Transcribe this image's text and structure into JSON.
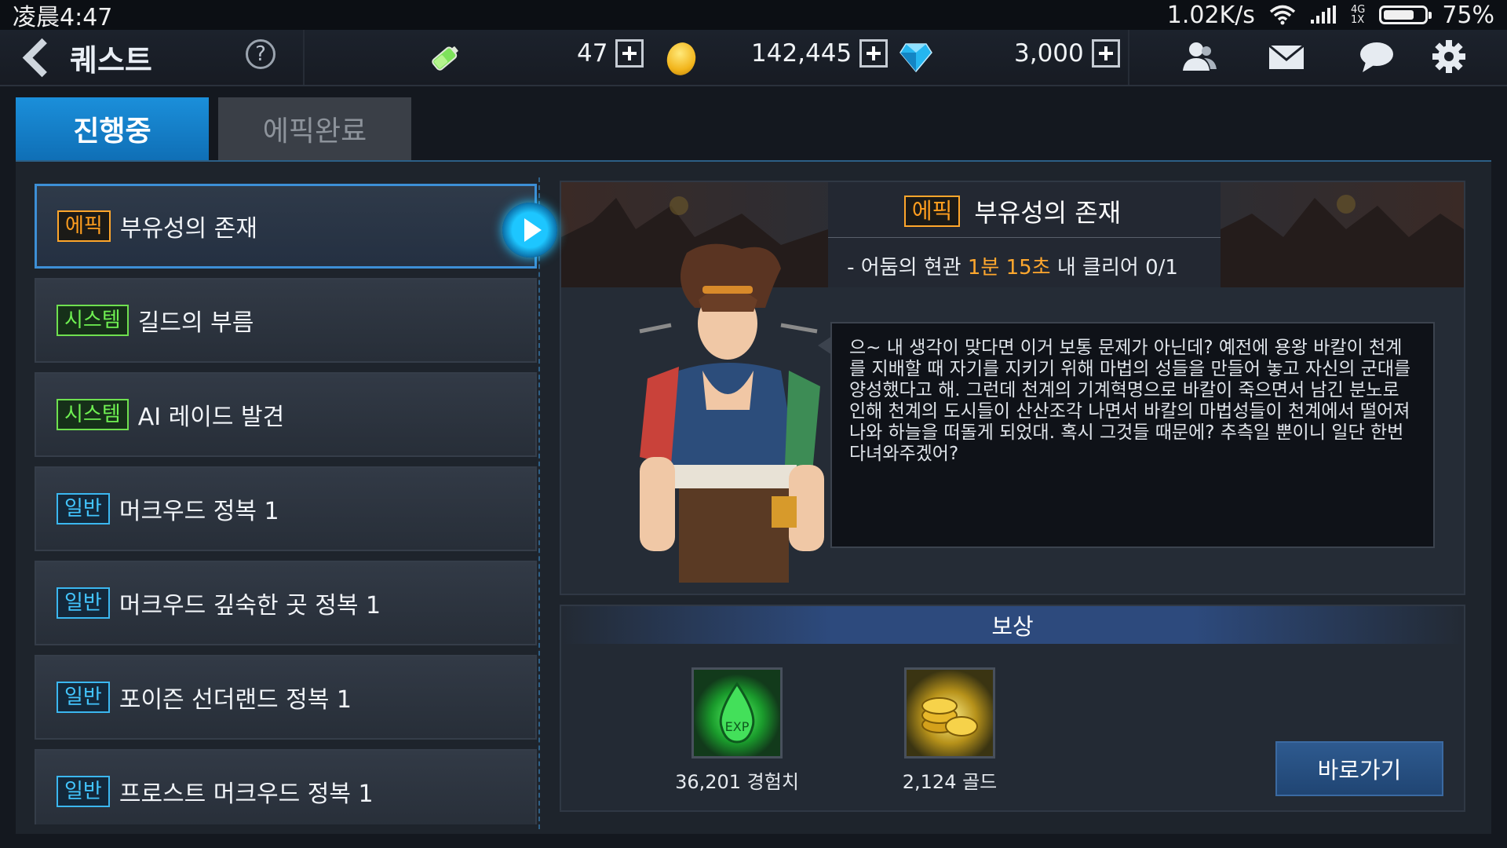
{
  "status_bar": {
    "time": "凌晨4:47",
    "network_speed": "1.02K/s",
    "network_type_top": "4G",
    "network_type_bottom": "1X",
    "battery": "75%",
    "battery_level": 0.75
  },
  "header": {
    "title": "퀘스트",
    "help_label": "?",
    "resources": [
      {
        "name": "stamina",
        "value": "47",
        "icon": "battery-icon"
      },
      {
        "name": "gold",
        "value": "142,445",
        "icon": "coin-icon"
      },
      {
        "name": "gem",
        "value": "3,000",
        "icon": "gem-icon"
      }
    ],
    "icons": [
      "friends-icon",
      "mail-icon",
      "chat-icon",
      "settings-icon"
    ]
  },
  "tabs": [
    {
      "label": "진행중",
      "active": true
    },
    {
      "label": "에픽완료",
      "active": false
    }
  ],
  "quests": [
    {
      "tag": "에픽",
      "type": "epic",
      "name": "부유성의 존재",
      "selected": true
    },
    {
      "tag": "시스템",
      "type": "system",
      "name": "길드의 부름"
    },
    {
      "tag": "시스템",
      "type": "system",
      "name": "AI 레이드 발견"
    },
    {
      "tag": "일반",
      "type": "normal",
      "name": "머크우드 정복 1"
    },
    {
      "tag": "일반",
      "type": "normal",
      "name": "머크우드 깊숙한 곳 정복 1"
    },
    {
      "tag": "일반",
      "type": "normal",
      "name": "포이즌 선더랜드 정복 1"
    },
    {
      "tag": "일반",
      "type": "normal",
      "name": "프로스트 머크우드 정복 1"
    }
  ],
  "detail": {
    "tag": "에픽",
    "title": "부유성의 존재",
    "objective_prefix": "- 어둠의 현관 ",
    "objective_time": "1분 15초",
    "objective_suffix": " 내 클리어 0/1",
    "dialogue": "으~ 내 생각이 맞다면 이거 보통 문제가 아닌데? 예전에 용왕 바칼이 천계를 지배할 때 자기를 지키기 위해 마법의 성들을 만들어 놓고 자신의 군대를 양성했다고 해. 그런데 천계의 기계혁명으로 바칼이 죽으면서 남긴 분노로 인해 천계의 도시들이 산산조각 나면서 바칼의 마법성들이 천계에서 떨어져 나와 하늘을 떠돌게 되었대. 혹시 그것들 때문에? 추측일 뿐이니 일단 한번 다녀와주겠어?"
  },
  "rewards": {
    "title": "보상",
    "items": [
      {
        "label": "36,201 경험치",
        "icon": "exp-potion-icon",
        "icon_text": "EXP"
      },
      {
        "label": "2,124 골드",
        "icon": "gold-coins-icon"
      }
    ],
    "goto_label": "바로가기"
  },
  "colors": {
    "accent_blue": "#1b8fda",
    "epic_orange": "#ff9e1f",
    "system_green": "#6ff052",
    "normal_cyan": "#43c6ff",
    "time_highlight": "#ffa72e"
  }
}
